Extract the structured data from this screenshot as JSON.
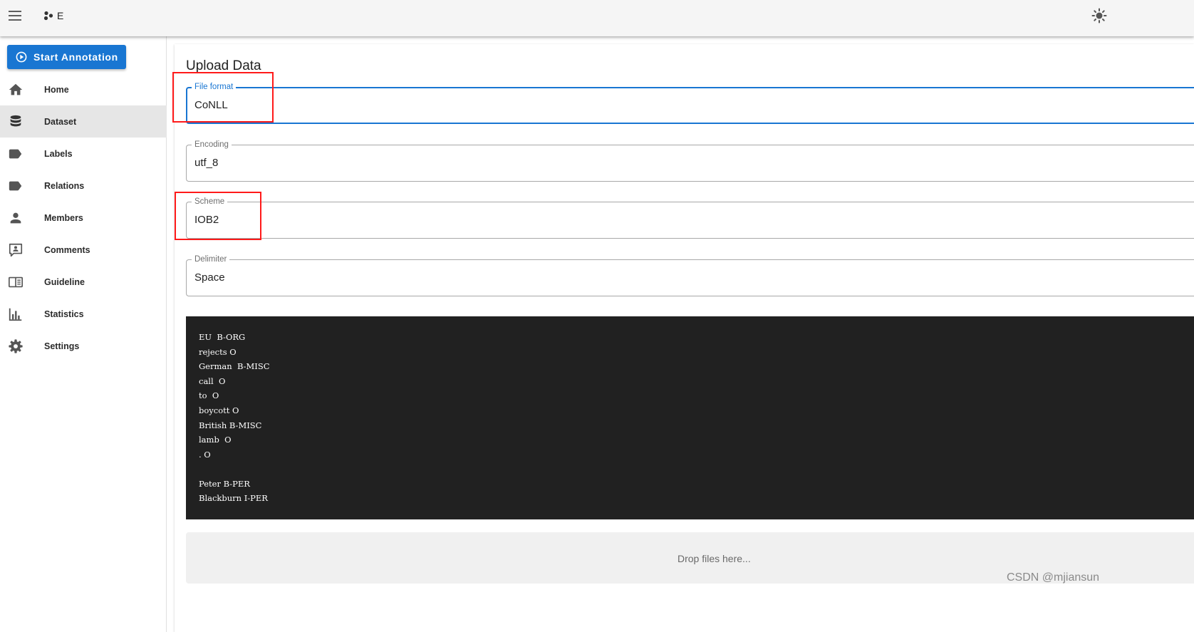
{
  "appbar": {
    "title": "E",
    "menu_icon": "hamburger-menu-icon",
    "logo_icon": "app-logo-icon",
    "theme_icon": "sun-theme-toggle-icon"
  },
  "sidebar": {
    "start_button": {
      "label": "Start Annotation",
      "icon": "play-circle-icon"
    },
    "items": [
      {
        "label": "Home",
        "icon": "home-icon",
        "active": false
      },
      {
        "label": "Dataset",
        "icon": "database-icon",
        "active": true
      },
      {
        "label": "Labels",
        "icon": "label-icon",
        "active": false
      },
      {
        "label": "Relations",
        "icon": "label-icon",
        "active": false
      },
      {
        "label": "Members",
        "icon": "person-icon",
        "active": false
      },
      {
        "label": "Comments",
        "icon": "comment-account-icon",
        "active": false
      },
      {
        "label": "Guideline",
        "icon": "book-open-icon",
        "active": false
      },
      {
        "label": "Statistics",
        "icon": "bar-chart-icon",
        "active": false
      },
      {
        "label": "Settings",
        "icon": "gear-icon",
        "active": false
      }
    ]
  },
  "main": {
    "title": "Upload Data",
    "fields": {
      "file_format": {
        "label": "File format",
        "value": "CoNLL"
      },
      "encoding": {
        "label": "Encoding",
        "value": "utf_8"
      },
      "scheme": {
        "label": "Scheme",
        "value": "IOB2"
      },
      "delimiter": {
        "label": "Delimiter",
        "value": "Space"
      }
    },
    "example_lines": [
      "EU  B-ORG",
      "rejects O",
      "German  B-MISC",
      "call  O",
      "to  O",
      "boycott O",
      "British B-MISC",
      "lamb  O",
      ". O",
      "",
      "Peter B-PER",
      "Blackburn I-PER"
    ],
    "dropzone_text": "Drop files here..."
  },
  "watermark": "CSDN @mjiansun",
  "colors": {
    "primary": "#1976d2",
    "appbar_bg": "#f5f5f5",
    "code_bg": "#212121",
    "highlight": "#ff1a1a",
    "active_nav_bg": "#e6e6e6"
  }
}
